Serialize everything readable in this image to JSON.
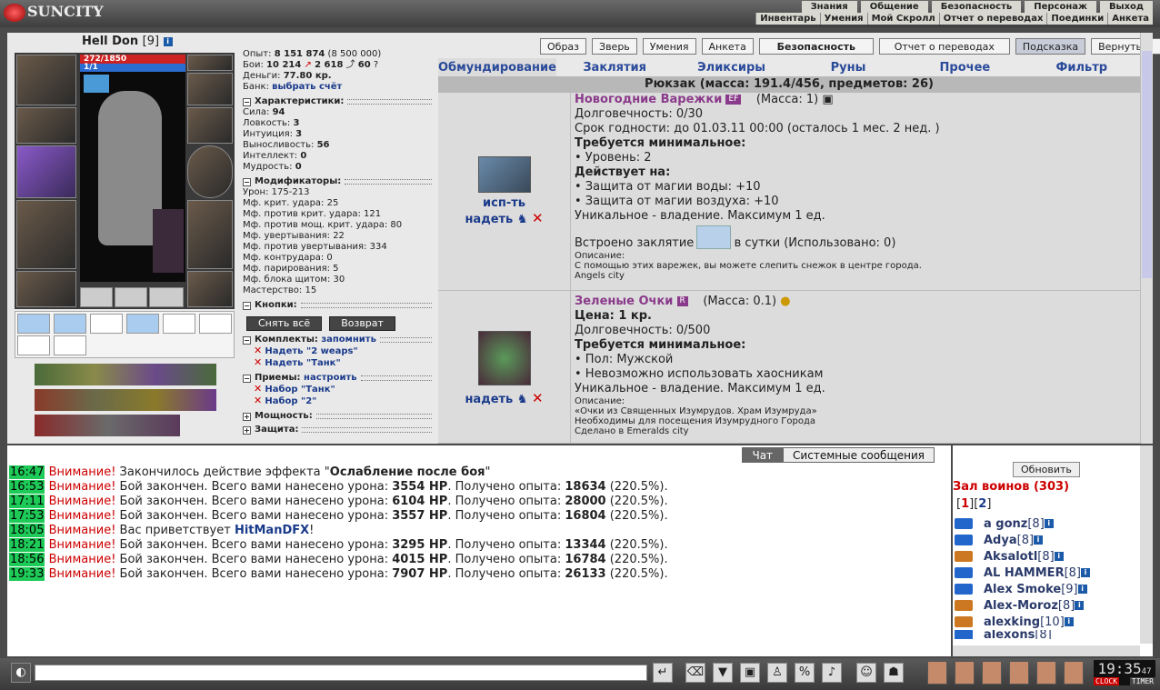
{
  "app": {
    "logo": "SUNCITY"
  },
  "nav": {
    "top": [
      "Знания",
      "Общение",
      "Безопасность",
      "Персонаж",
      "Выход"
    ],
    "sub": [
      "Инвентарь",
      "Умения",
      "Мой Скролл",
      "Отчет о переводах",
      "Поединки",
      "Анкета"
    ]
  },
  "character": {
    "name": "Hell Don",
    "level": "[9]",
    "hp": "272/1850",
    "mp": "1/1"
  },
  "info": {
    "exp_label": "Опыт:",
    "exp": "8 151 874",
    "exp_next": "(8 500 000)",
    "fights_label": "Бои:",
    "wins": "10 214",
    "losses": "2 618",
    "draws": "60",
    "money_label": "Деньги:",
    "money": "77.80 кр.",
    "bank_label": "Банк:",
    "bank_link": "выбрать счёт"
  },
  "characteristics": {
    "title": "Характеристики:",
    "items": [
      {
        "l": "Сила:",
        "v": "94"
      },
      {
        "l": "Ловкость:",
        "v": "3"
      },
      {
        "l": "Интуиция:",
        "v": "3"
      },
      {
        "l": "Выносливость:",
        "v": "56"
      },
      {
        "l": "Интеллект:",
        "v": "0"
      },
      {
        "l": "Мудрость:",
        "v": "0"
      }
    ]
  },
  "modifiers": {
    "title": "Модификаторы:",
    "items": [
      "Урон: 175-213",
      "Мф. крит. удара: 25",
      "Мф. против крит. удара: 121",
      "Мф. против мощ. крит. удара: 80",
      "Мф. увертывания: 22",
      "Мф. против увертывания: 334",
      "Мф. контрудара: 0",
      "Мф. парирования: 5",
      "Мф. блока щитом: 30",
      "Мастерство: 15"
    ]
  },
  "buttons_section": {
    "title": "Кнопки:",
    "remove_all": "Снять всё",
    "return": "Возврат"
  },
  "sets": {
    "title": "Комплекты:",
    "remember": "запомнить",
    "items": [
      "Надеть \"2 weaps\"",
      "Надеть \"Танк\""
    ]
  },
  "techniques": {
    "title": "Приемы:",
    "configure": "настроить",
    "items": [
      "Набор \"Танк\"",
      "Набор \"2\""
    ]
  },
  "powers": {
    "title": "Мощность:"
  },
  "protection": {
    "title": "Защита:"
  },
  "tabs_top": [
    "Образ",
    "Зверь",
    "Умения",
    "Анкета",
    "Безопасность",
    "Отчет о переводах",
    "Подсказка",
    "Вернуться"
  ],
  "tabs_inv": [
    "Обмундирование",
    "Заклятия",
    "Эликсиры",
    "Руны",
    "Прочее",
    "Фильтр"
  ],
  "backpack": "Рюкзак (масса: 191.4/456, предметов: 26)",
  "items": [
    {
      "name": "Новогодние Варежки",
      "tag": "EF",
      "mass": "(Масса: 1)",
      "use": "исп-ть",
      "wear": "надеть",
      "lines": [
        [
          "",
          "Долговечность: 0/30"
        ],
        [
          "",
          "Срок годности: до 01.03.11 00:00 (осталось 1 мес. 2 нед. )"
        ],
        [
          "b",
          "Требуется минимальное:"
        ],
        [
          "",
          "• Уровень: 2"
        ],
        [
          "b",
          "Действует на:"
        ],
        [
          "",
          "• Защита от магии воды: +10"
        ],
        [
          "",
          "• Защита от магии воздуха: +10"
        ],
        [
          "",
          "Уникальное - владение. Максимум 1 ед."
        ],
        [
          "s",
          ""
        ],
        [
          "",
          "Встроено заклятие          5 шт. в сутки (Использовано: 0)"
        ],
        [
          "m",
          "Описание:"
        ],
        [
          "m",
          "С помощью этих варежек, вы можете слепить снежок в центре города."
        ],
        [
          "m",
          "Angels city"
        ]
      ]
    },
    {
      "name": "Зеленые Очки",
      "tag": "R",
      "mass": "(Масса: 0.1)",
      "wear": "надеть",
      "lines": [
        [
          "b",
          "Цена: 1 кр."
        ],
        [
          "",
          "Долговечность: 0/500"
        ],
        [
          "b",
          "Требуется минимальное:"
        ],
        [
          "",
          "• Пол: Мужской"
        ],
        [
          "",
          "• Невозможно использовать хаосникам"
        ],
        [
          "",
          "Уникальное - владение. Максимум 1 ед."
        ],
        [
          "m",
          "Описание:"
        ],
        [
          "m",
          "«Очки из Священных Изумрудов. Храм Изумруда»"
        ],
        [
          "m",
          "Необходимы для посещения Изумрудного Города"
        ],
        [
          "m",
          "Сделано в Emeralds city"
        ]
      ]
    }
  ],
  "chat_tabs": {
    "chat": "Чат",
    "system": "Системные сообщения"
  },
  "messages": [
    {
      "t": "16:47",
      "w": "Внимание!",
      "a": " Закончилось действие эффекта \"",
      "b": "Ослабление после боя",
      "c": "\""
    },
    {
      "t": "16:53",
      "w": "Внимание!",
      "a": " Бой закончен. Всего вами нанесено урона: ",
      "b": "3554 HP",
      "c": ". Получено опыта: ",
      "d": "18634",
      "e": " (220.5%)."
    },
    {
      "t": "17:11",
      "w": "Внимание!",
      "a": " Бой закончен. Всего вами нанесено урона: ",
      "b": "6104 HP",
      "c": ". Получено опыта: ",
      "d": "28000",
      "e": " (220.5%)."
    },
    {
      "t": "17:53",
      "w": "Внимание!",
      "a": " Бой закончен. Всего вами нанесено урона: ",
      "b": "3557 HP",
      "c": ". Получено опыта: ",
      "d": "16804",
      "e": " (220.5%)."
    },
    {
      "t": "18:05",
      "w": "Внимание!",
      "a": " Вас приветствует ",
      "b": "HitManDFX",
      "c": "!"
    },
    {
      "t": "18:21",
      "w": "Внимание!",
      "a": " Бой закончен. Всего вами нанесено урона: ",
      "b": "3295 HP",
      "c": ". Получено опыта: ",
      "d": "13344",
      "e": " (220.5%)."
    },
    {
      "t": "18:56",
      "w": "Внимание!",
      "a": " Бой закончен. Всего вами нанесено урона: ",
      "b": "4015 HP",
      "c": ". Получено опыта: ",
      "d": "16784",
      "e": " (220.5%)."
    },
    {
      "t": "19:33",
      "w": "Внимание!",
      "a": " Бой закончен. Всего вами нанесено урона: ",
      "b": "7907 HP",
      "c": ". Получено опыта: ",
      "d": "26133",
      "e": " (220.5%)."
    }
  ],
  "who": {
    "refresh": "Обновить",
    "room": "Зал воинов (303)",
    "pages": [
      "1",
      "2"
    ],
    "players": [
      {
        "n": "a gonz",
        "l": "[8]"
      },
      {
        "n": "Adya",
        "l": "[8]"
      },
      {
        "n": "Aksalotl",
        "l": "[8]"
      },
      {
        "n": "AL HAMMER",
        "l": "[8]"
      },
      {
        "n": "Alex Smoke",
        "l": "[9]"
      },
      {
        "n": "Alex-Moroz",
        "l": "[8]"
      },
      {
        "n": "alexking",
        "l": "[10]"
      },
      {
        "n": "alexons",
        "l": "[8]"
      }
    ]
  },
  "clock": {
    "time": "19:35",
    "sec": "47",
    "clock_label": "CLOCK",
    "timer_label": "TIMER"
  }
}
